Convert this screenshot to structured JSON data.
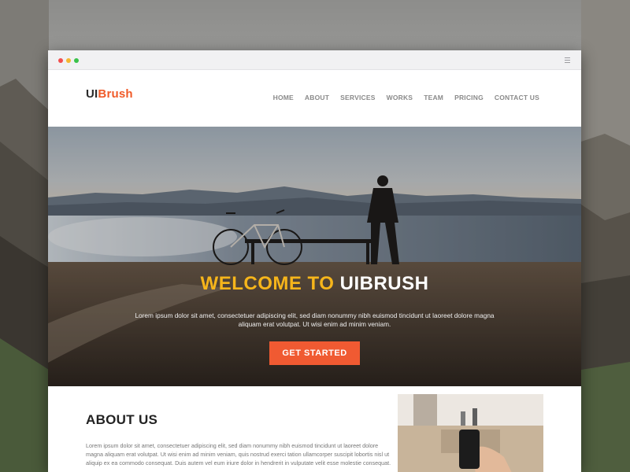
{
  "brand": {
    "part1": "UI",
    "part2": "Brush"
  },
  "nav": {
    "items": [
      {
        "label": "HOME"
      },
      {
        "label": "ABOUT"
      },
      {
        "label": "SERVICES"
      },
      {
        "label": "WORKS"
      },
      {
        "label": "TEAM"
      },
      {
        "label": "PRICING"
      },
      {
        "label": "CONTACT US"
      }
    ]
  },
  "hero": {
    "title_part1": "WELCOME TO",
    "title_part2": "UIBRUSH",
    "text": "Lorem ipsum dolor sit amet, consectetuer adipiscing elit, sed diam nonummy nibh euismod tincidunt ut laoreet dolore magna aliquam erat volutpat. Ut wisi enim ad minim veniam.",
    "cta_label": "GET STARTED"
  },
  "about": {
    "heading": "ABOUT US",
    "text": "Lorem ipsum dolor sit amet, consectetuer adipiscing elit, sed diam nonummy nibh euismod tincidunt ut laoreet dolore magna aliquam erat volutpat. Ut wisi enim ad minim veniam, quis nostrud exerci tation ullamcorper suscipit lobortis nisl ut aliquip ex ea commodo consequat. Duis autem vel eum iriure dolor in hendrerit in vulputate velit esse molestie consequat."
  },
  "colors": {
    "accent": "#f05a28",
    "title_highlight": "#f6b51b",
    "dot_red": "#f24e4e",
    "dot_yellow": "#f4b730",
    "dot_green": "#39c24a"
  },
  "icons": {
    "window_menu": "hamburger-menu-icon"
  }
}
